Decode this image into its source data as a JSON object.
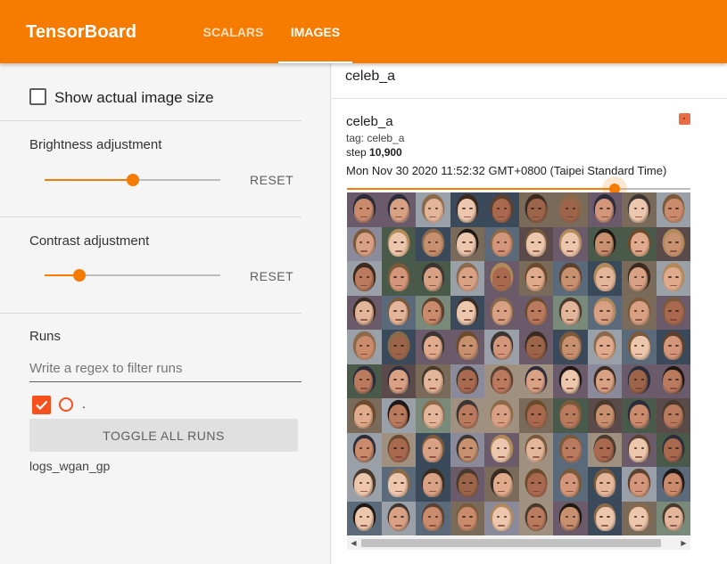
{
  "app": {
    "title": "TensorBoard"
  },
  "tabs": [
    {
      "label": "SCALARS",
      "active": false
    },
    {
      "label": "IMAGES",
      "active": true
    }
  ],
  "sidebar": {
    "show_actual_size": {
      "label": "Show actual image size",
      "checked": false
    },
    "brightness": {
      "label": "Brightness adjustment",
      "value_fraction": 0.5,
      "reset_label": "RESET"
    },
    "contrast": {
      "label": "Contrast adjustment",
      "value_fraction": 0.2,
      "reset_label": "RESET"
    },
    "runs": {
      "title": "Runs",
      "filter_placeholder": "Write a regex to filter runs",
      "filter_value": "",
      "all_checked": true,
      "dot_label": ".",
      "toggle_label": "TOGGLE ALL RUNS",
      "items": [
        {
          "name": "logs_wgan_gp"
        }
      ]
    }
  },
  "main": {
    "tag_group": "celeb_a",
    "card": {
      "title": "celeb_a",
      "tag_text": "tag: celeb_a",
      "step_prefix": "step ",
      "step_value": "10,900",
      "timestamp": "Mon Nov 30 2020 11:52:32 GMT+0800 (Taipei Standard Time)",
      "step_slider_fraction": 0.78,
      "run_color": "#e86c46"
    },
    "image_grid": {
      "rows": 10,
      "cols": 10,
      "content": "generated-face-samples"
    }
  },
  "colors": {
    "accent": "#f57c00",
    "run": "#f4511e"
  },
  "icons": {
    "checkbox": "checkbox-empty-icon",
    "run_checkbox": "checkbox-checked-icon",
    "run_circle": "radio-circle-icon",
    "scroll_left": "arrow-left-icon",
    "scroll_right": "arrow-right-icon"
  }
}
